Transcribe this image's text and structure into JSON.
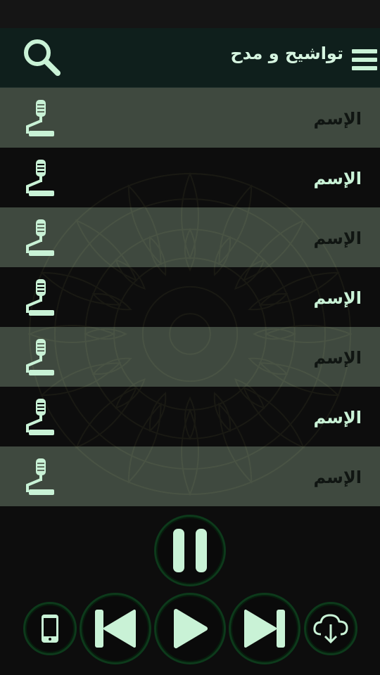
{
  "header": {
    "title": "تواشيح و مدح",
    "menu_icon": "hamburger-menu-icon",
    "search_icon": "search-icon"
  },
  "list": {
    "items": [
      {
        "label": "الإسم",
        "icon": "paint-roller-icon"
      },
      {
        "label": "الإسم",
        "icon": "paint-roller-icon"
      },
      {
        "label": "الإسم",
        "icon": "paint-roller-icon"
      },
      {
        "label": "الإسم",
        "icon": "paint-roller-icon"
      },
      {
        "label": "الإسم",
        "icon": "paint-roller-icon"
      },
      {
        "label": "الإسم",
        "icon": "paint-roller-icon"
      },
      {
        "label": "الإسم",
        "icon": "paint-roller-icon"
      }
    ]
  },
  "player": {
    "controls": [
      "pause-icon",
      "phone-icon",
      "skip-previous-icon",
      "play-icon",
      "skip-next-icon",
      "cloud-download-icon"
    ]
  },
  "colors": {
    "accent": "#c9f2d6",
    "header_bg": "#0f1f1c",
    "button_ring": "#0d3a1b",
    "row_light": "#606f60",
    "background": "#0d0d0d"
  }
}
